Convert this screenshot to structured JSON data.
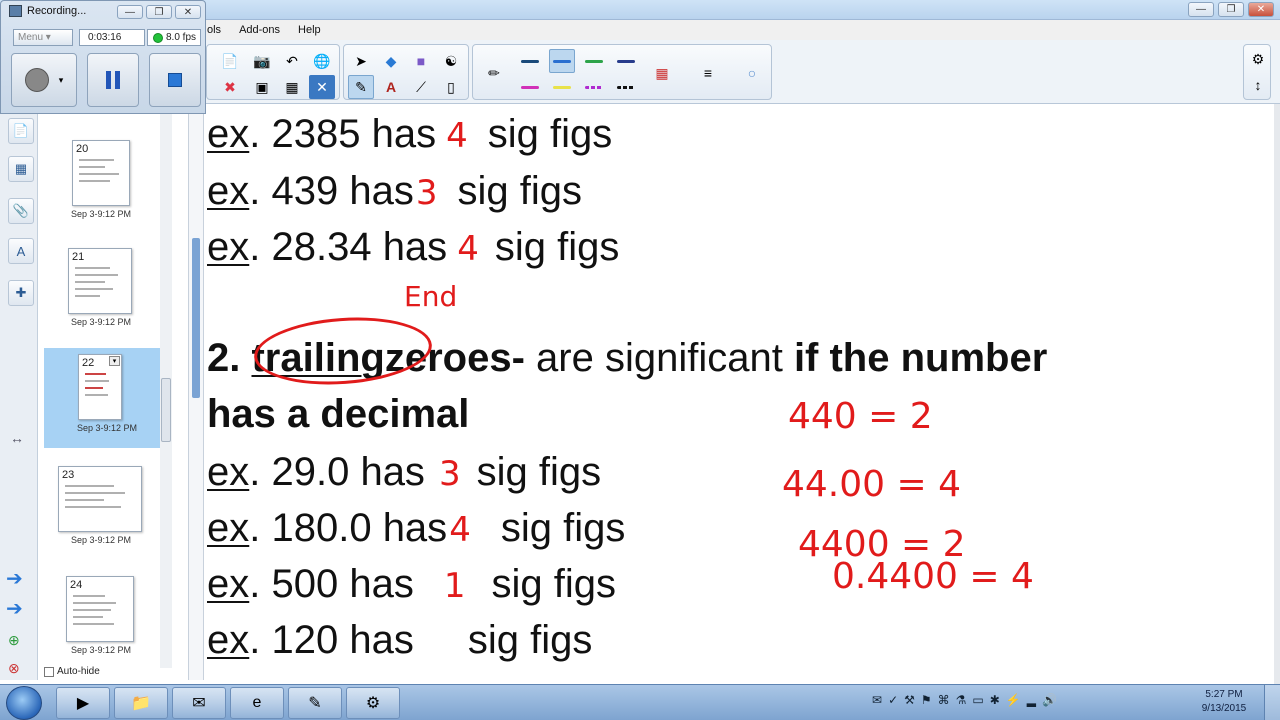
{
  "recorder": {
    "title": "Recording...",
    "menu_label": "Menu",
    "elapsed": "0:03:16",
    "fps": "8.0 fps"
  },
  "menubar": {
    "items": [
      "ols",
      "Add-ons",
      "Help"
    ]
  },
  "thumbnails": [
    {
      "number": "20",
      "date": "Sep 3-9:12 PM"
    },
    {
      "number": "21",
      "date": "Sep 3-9:12 PM"
    },
    {
      "number": "22",
      "date": "Sep 3-9:12 PM"
    },
    {
      "number": "23",
      "date": "Sep 3-9:12 PM"
    },
    {
      "number": "24",
      "date": "Sep 3-9:12 PM"
    }
  ],
  "autohide_label": "Auto-hide",
  "slide": {
    "ex_word": "ex",
    "line1": {
      "rest": ". 2385 has",
      "ink": "4",
      "tail": "sig figs"
    },
    "line2": {
      "rest": ". 439 has",
      "ink": "3",
      "tail": "sig figs"
    },
    "line3": {
      "rest": ". 28.34 has",
      "ink": "4",
      "tail": "sig figs"
    },
    "end_note": "End",
    "rule": {
      "number": "2.",
      "keyword": "trailing",
      "bold_after": "zeroes-",
      "normal": "are significant",
      "bold_tail": "if the number",
      "line2": "has a decimal"
    },
    "line4": {
      "rest": ". 29.0 has",
      "ink": "3",
      "tail": "sig figs"
    },
    "line5": {
      "rest": ". 180.0 has",
      "ink": "4",
      "tail": "sig figs"
    },
    "line6": {
      "rest": ". 500  has",
      "ink": "1",
      "tail": "sig figs"
    },
    "line7": {
      "rest": ". 120 has",
      "tail": "sig figs"
    },
    "notes": [
      "440 = 2",
      "44.00 = 4",
      "4400 = 2",
      "0.4400 = 4"
    ]
  },
  "taskbar": {
    "clock_time": "5:27 PM",
    "clock_date": "9/13/2015"
  },
  "colors": {
    "ink": "#e11b1b",
    "selected_thumb": "#a7d2f4"
  }
}
